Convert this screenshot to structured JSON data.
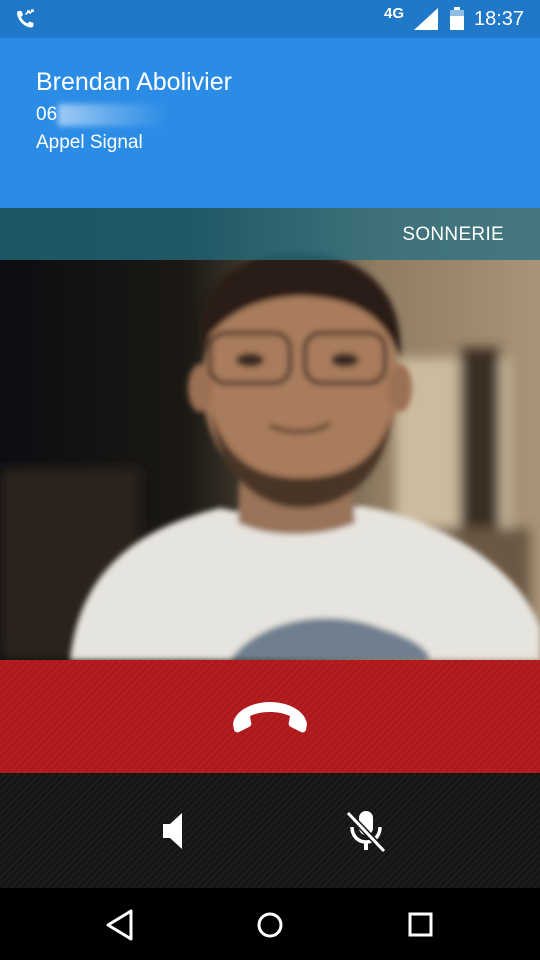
{
  "status_bar": {
    "network": "4G",
    "time": "18:37",
    "icons": [
      "phone-call-icon",
      "signal-icon",
      "battery-icon"
    ]
  },
  "call": {
    "contact_name": "Brendan Abolivier",
    "number": "06",
    "call_type": "Appel Signal",
    "state": "SONNERIE"
  },
  "controls": {
    "hangup_icon": "hangup-icon",
    "speaker_icon": "speaker-icon",
    "mic_icon": "mic-muted-icon"
  },
  "nav": {
    "icons": [
      "back-icon",
      "home-icon",
      "recents-icon"
    ]
  },
  "colors": {
    "status_bar": "#1f78c8",
    "header": "#2b8ce6",
    "state_bar": "#236e82",
    "hangup": "#b51d20",
    "controls": "#1a1a1a"
  }
}
